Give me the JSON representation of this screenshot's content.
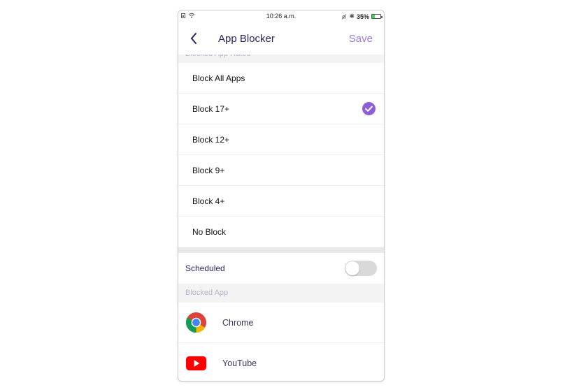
{
  "status_bar": {
    "time": "10:26 a.m.",
    "battery": "35%",
    "battery_level": 0.35
  },
  "header": {
    "title": "App Blocker",
    "save_label": "Save",
    "back_icon": "chevron-left-icon"
  },
  "rating_section": {
    "label": "Blocked App Rated",
    "options": [
      {
        "label": "Block All Apps",
        "selected": false
      },
      {
        "label": "Block 17+",
        "selected": true
      },
      {
        "label": "Block 12+",
        "selected": false
      },
      {
        "label": "Block 9+",
        "selected": false
      },
      {
        "label": "Block 4+",
        "selected": false
      },
      {
        "label": "No Block",
        "selected": false
      }
    ]
  },
  "scheduled": {
    "label": "Scheduled",
    "enabled": false
  },
  "blocked_apps": {
    "label": "Blocked App",
    "apps": [
      {
        "name": "Chrome",
        "icon": "chrome-icon"
      },
      {
        "name": "YouTube",
        "icon": "youtube-icon"
      }
    ]
  },
  "colors": {
    "accent": "#8c5ed8",
    "save": "#9b7be0",
    "title": "#2a2560"
  }
}
